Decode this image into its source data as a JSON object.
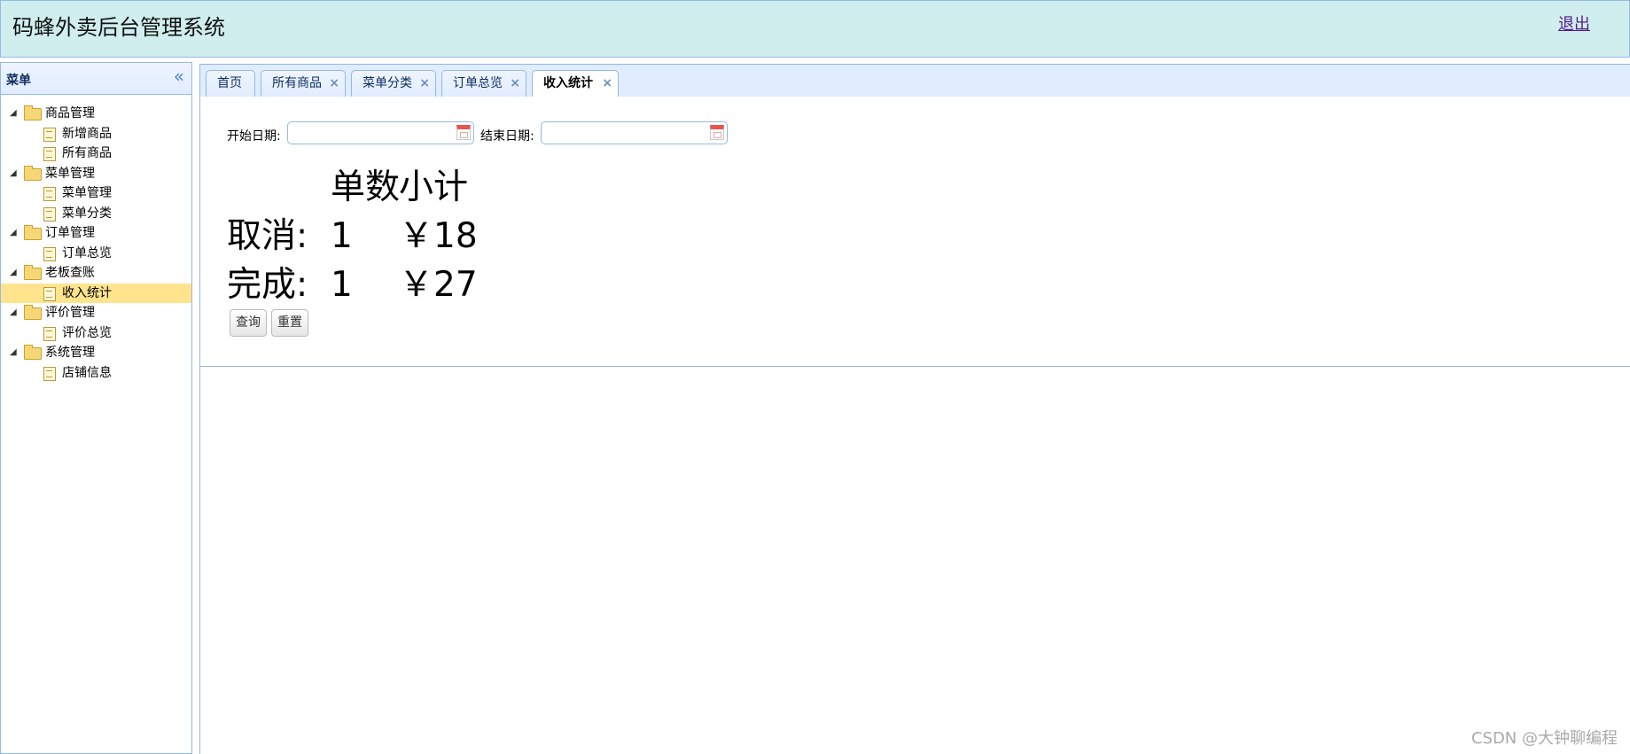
{
  "header": {
    "title": "码蜂外卖后台管理系统",
    "logout": "退出"
  },
  "sidebar": {
    "title": "菜单",
    "groups": [
      {
        "label": "商品管理",
        "items": [
          "新增商品",
          "所有商品"
        ]
      },
      {
        "label": "菜单管理",
        "items": [
          "菜单管理",
          "菜单分类"
        ]
      },
      {
        "label": "订单管理",
        "items": [
          "订单总览"
        ]
      },
      {
        "label": "老板查账",
        "items": [
          "收入统计"
        ]
      },
      {
        "label": "评价管理",
        "items": [
          "评价总览"
        ]
      },
      {
        "label": "系统管理",
        "items": [
          "店铺信息"
        ]
      }
    ],
    "selected": "收入统计"
  },
  "tabs": [
    {
      "label": "首页",
      "closable": false
    },
    {
      "label": "所有商品",
      "closable": true
    },
    {
      "label": "菜单分类",
      "closable": true
    },
    {
      "label": "订单总览",
      "closable": true
    },
    {
      "label": "收入统计",
      "closable": true,
      "active": true
    }
  ],
  "filter": {
    "start_label": "开始日期:",
    "end_label": "结束日期:",
    "start_value": "",
    "end_value": ""
  },
  "stats": {
    "headers": [
      "单数",
      "小计"
    ],
    "rows": [
      {
        "label": "取消:",
        "count": "1",
        "amount": "￥18"
      },
      {
        "label": "完成:",
        "count": "1",
        "amount": "￥27"
      }
    ]
  },
  "buttons": {
    "query": "查询",
    "reset": "重置"
  },
  "watermark": "CSDN @大钟聊编程",
  "colors": {
    "header_bg": "#d0eeee",
    "border": "#95b8e7",
    "selected_bg": "#ffe48d",
    "tab_bar_bg": "#e0ecff"
  }
}
